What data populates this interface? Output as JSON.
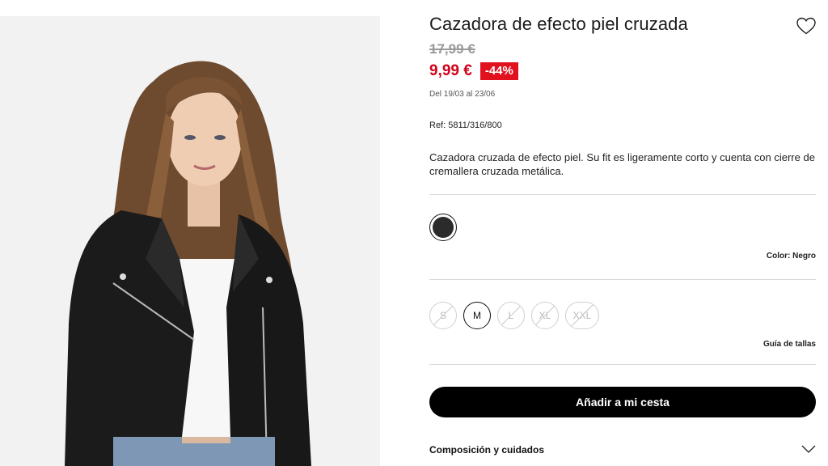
{
  "product": {
    "title": "Cazadora de efecto piel cruzada",
    "old_price": "17,99 €",
    "new_price": "9,99 €",
    "discount": "-44%",
    "dates": "Del 19/03 al 23/06",
    "ref": "Ref: 5811/316/800",
    "description": "Cazadora cruzada de efecto piel. Su fit es ligeramente corto y cuenta con cierre de cremallera cruzada metálica."
  },
  "colors": {
    "selected_label": "Color: Negro",
    "swatches": [
      {
        "name": "Negro",
        "hex": "#2b2b2b",
        "selected": true
      }
    ]
  },
  "sizes": {
    "options": [
      {
        "label": "S",
        "available": false
      },
      {
        "label": "M",
        "available": true
      },
      {
        "label": "L",
        "available": false
      },
      {
        "label": "XL",
        "available": false
      },
      {
        "label": "XXL",
        "available": false
      }
    ],
    "guide_label": "Guía de tallas"
  },
  "actions": {
    "add_to_cart": "Añadir a mi cesta"
  },
  "accordion": {
    "composition_label": "Composición y cuidados"
  },
  "icons": {
    "wishlist": "heart-outline-icon",
    "accordion": "chevron-down-icon"
  },
  "theme": {
    "sale_red": "#e1111e",
    "price_red": "#d0021b",
    "button_bg": "#000000"
  }
}
